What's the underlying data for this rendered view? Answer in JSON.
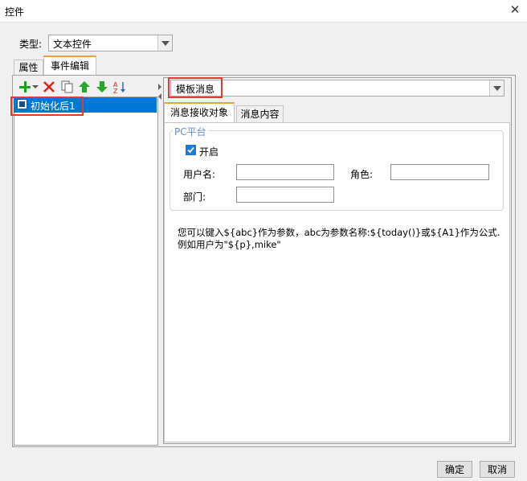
{
  "window": {
    "title": "控件"
  },
  "type_row": {
    "label": "类型:",
    "value": "文本控件"
  },
  "tabs": [
    {
      "label": "属性"
    },
    {
      "label": "事件编辑"
    }
  ],
  "event_list": {
    "items": [
      {
        "label": "初始化后1"
      }
    ]
  },
  "template": {
    "value": "模板消息"
  },
  "sub_tabs": [
    {
      "label": "消息接收对象"
    },
    {
      "label": "消息内容"
    }
  ],
  "pc_platform": {
    "group_label": "PC平台",
    "enable_label": "开启",
    "enabled": true,
    "username_label": "用户名:",
    "role_label": "角色:",
    "department_label": "部门:",
    "username_value": "",
    "role_value": "",
    "department_value": ""
  },
  "hint": {
    "line1": "您可以键入${abc}作为参数，abc为参数名称:${today()}或${A1}作为公式.",
    "line2": "例如用户为\"${p},mike\""
  },
  "footer": {
    "ok_label": "确定",
    "cancel_label": "取消"
  },
  "colors": {
    "highlight": "#e53935",
    "tab_accent": "#e8a33d",
    "selection": "#0078d7",
    "add_icon": "#1aa31a",
    "delete_icon": "#e02020",
    "arrow_icon": "#2aa52a"
  },
  "icons": [
    "close-icon",
    "add-icon",
    "dropdown-small-icon",
    "delete-icon",
    "copy-icon",
    "move-up-icon",
    "move-down-icon",
    "sort-icon",
    "event-icon",
    "checkbox-checked-icon"
  ]
}
